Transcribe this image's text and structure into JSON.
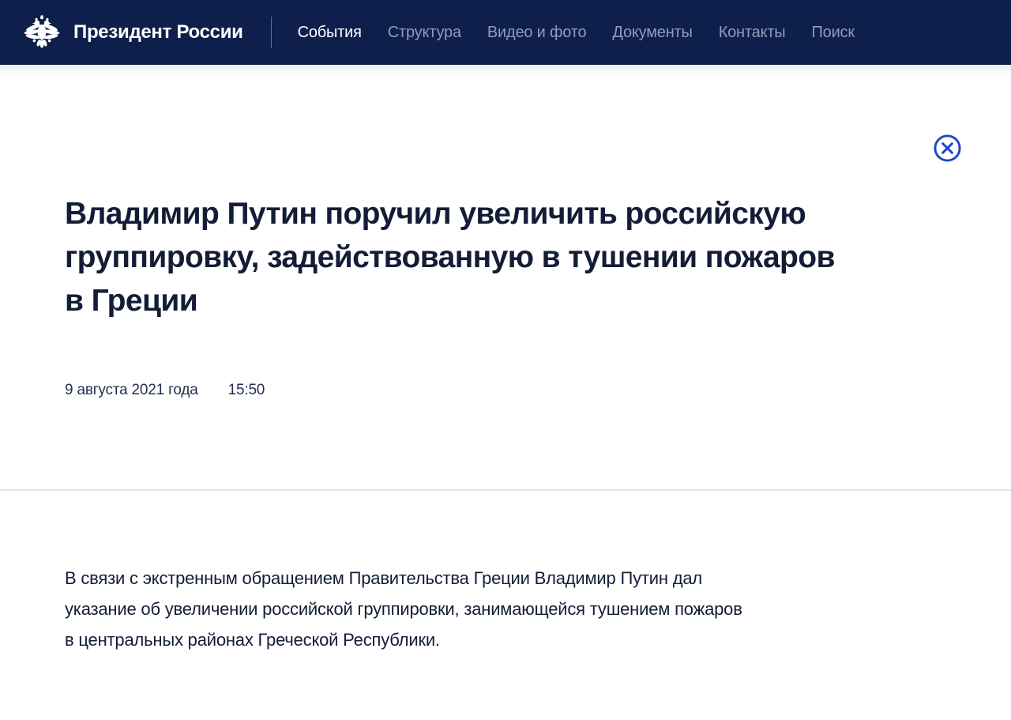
{
  "brand": {
    "site_title": "Президент России"
  },
  "nav": {
    "items": [
      {
        "label": "События",
        "active": true
      },
      {
        "label": "Структура",
        "active": false
      },
      {
        "label": "Видео и фото",
        "active": false
      },
      {
        "label": "Документы",
        "active": false
      },
      {
        "label": "Контакты",
        "active": false
      },
      {
        "label": "Поиск",
        "active": false
      }
    ]
  },
  "article": {
    "title": "Владимир Путин поручил увеличить российскую\nгруппировку, задействованную в тушении пожаров\nв Греции",
    "date": "9 августа 2021 года",
    "time": "15:50",
    "body": "В связи с экстренным обращением Правительства Греции Владимир Путин дал\nуказание об увеличении российской группировки, занимающейся тушением пожаров\nв центральных районах Греческой Республики."
  },
  "icons": {
    "logo": "russia-coat-of-arms-icon",
    "close": "close-icon"
  },
  "colors": {
    "navbar_bg": "#0e1f4b",
    "nav_inactive": "#8e9bba",
    "nav_active": "#ffffff",
    "accent_blue": "#1a46c8",
    "divider_teal": "#d6ebe8",
    "text_dark": "#131d36",
    "date_text": "#25304e",
    "header_shadow": "#e9ebee"
  }
}
